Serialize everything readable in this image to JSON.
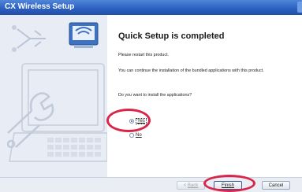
{
  "window": {
    "title": "CX Wireless Setup"
  },
  "main": {
    "heading": "Quick Setup is completed",
    "restart_text": "Please restart this product.",
    "continue_text": "You can continue the installation of the bundled applications with this product.",
    "question": "Do you want to install the applications?"
  },
  "options": {
    "yes_label": "Yes",
    "no_label": "No",
    "selected": "Yes"
  },
  "footer": {
    "back_label": "Back",
    "finish_label": "Finish",
    "cancel_label": "Cancel"
  },
  "colors": {
    "titlebar": "#2a5fc0",
    "highlight_circle": "#d8264a",
    "sidebar": "#e8edf5"
  }
}
